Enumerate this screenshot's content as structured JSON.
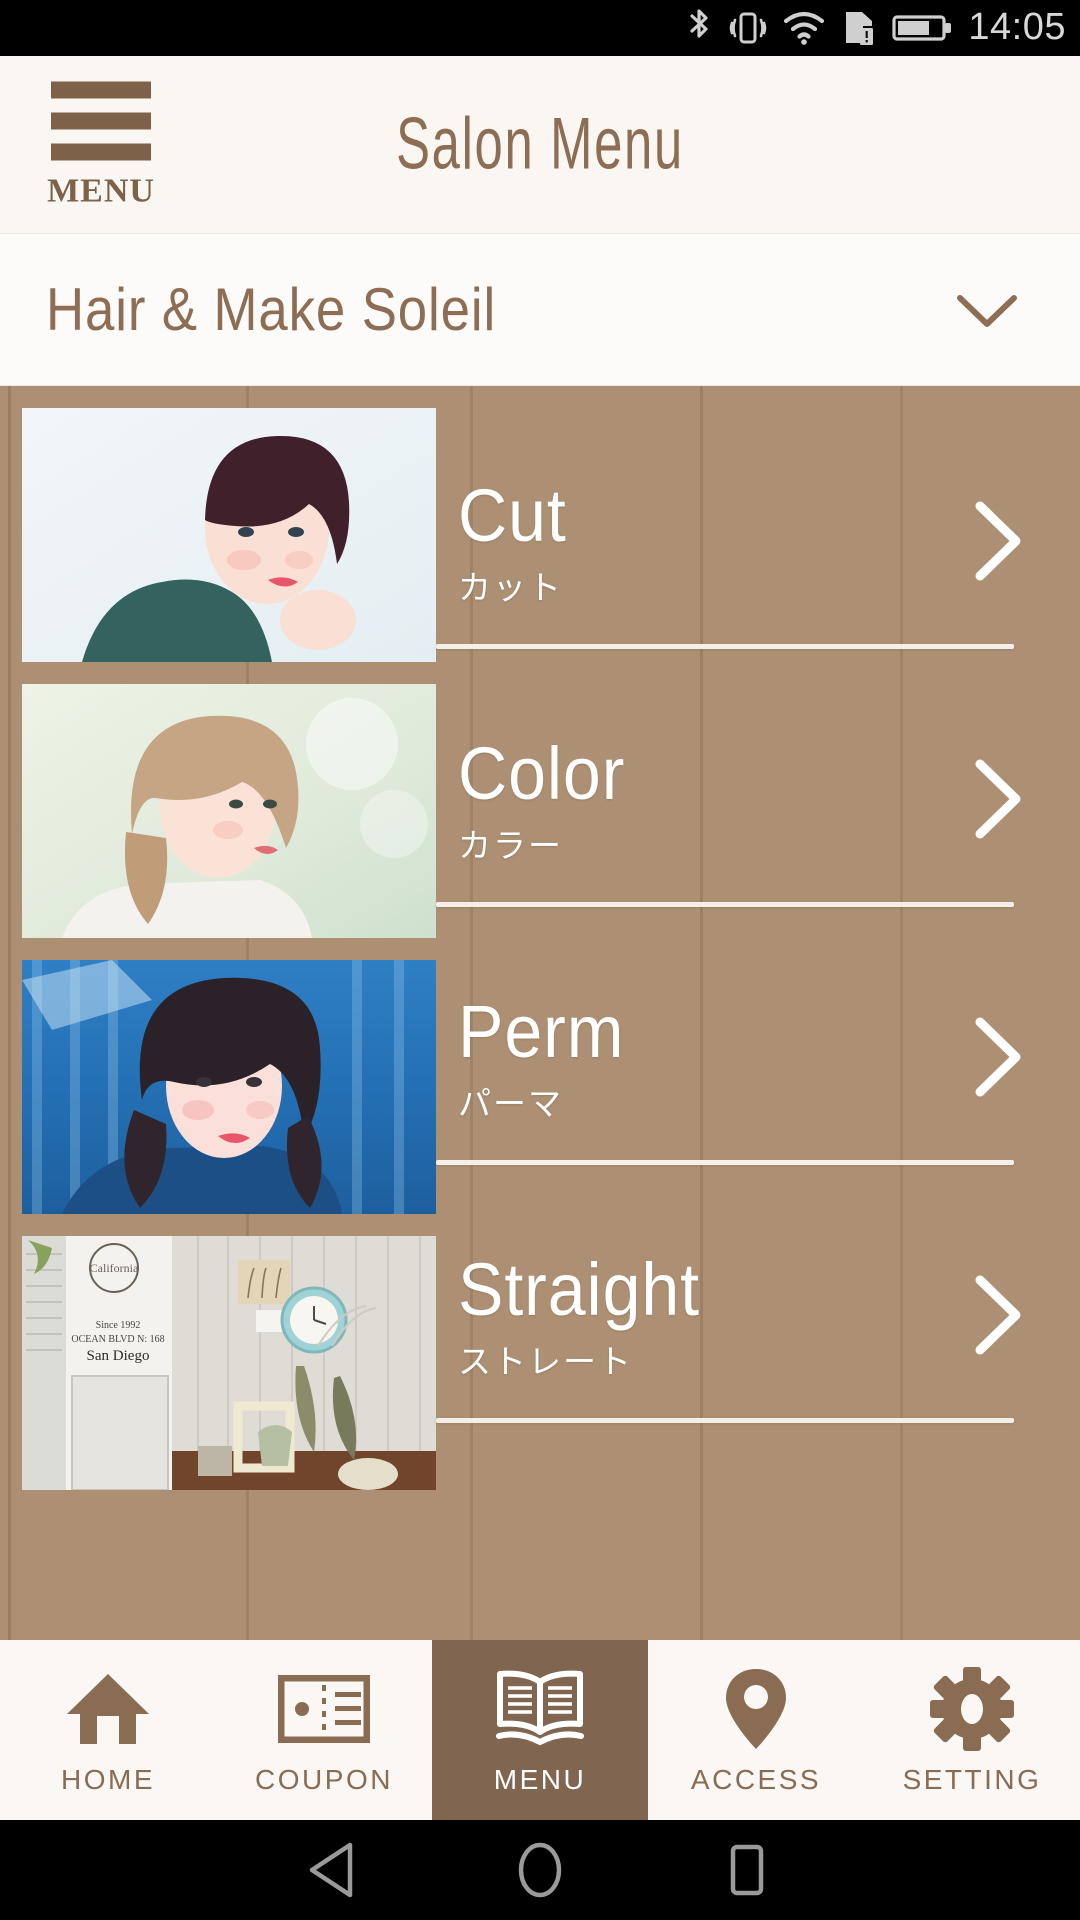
{
  "status_bar": {
    "time": "14:05",
    "icons": [
      "bluetooth-icon",
      "vibrate-icon",
      "wifi-icon",
      "sim-card-alert-icon",
      "battery-icon"
    ],
    "battery_level_percent": 70
  },
  "app_header": {
    "menu_button_label": "MENU",
    "title": "Salon Menu"
  },
  "salon_selector": {
    "name": "Hair & Make Soleil",
    "expand_icon": "chevron-down-icon"
  },
  "menu_list": {
    "items": [
      {
        "title_en": "Cut",
        "title_jp": "カット",
        "thumb_alt": "short-dark-bob-hairstyle-portrait",
        "chevron": "chevron-right-icon"
      },
      {
        "title_en": "Color",
        "title_jp": "カラー",
        "thumb_alt": "light-brown-medium-hair-portrait",
        "chevron": "chevron-right-icon"
      },
      {
        "title_en": "Perm",
        "title_jp": "パーマ",
        "thumb_alt": "wavy-dark-hair-blue-background-portrait",
        "chevron": "chevron-right-icon"
      },
      {
        "title_en": "Straight",
        "title_jp": "ストレート",
        "thumb_alt": "salon-interior-vintage-decor-clock",
        "chevron": "chevron-right-icon"
      }
    ]
  },
  "tab_bar": {
    "active_index": 2,
    "tabs": [
      {
        "label": "HOME",
        "icon": "home-icon"
      },
      {
        "label": "COUPON",
        "icon": "coupon-ticket-icon"
      },
      {
        "label": "MENU",
        "icon": "open-book-icon"
      },
      {
        "label": "ACCESS",
        "icon": "map-pin-icon"
      },
      {
        "label": "SETTING",
        "icon": "gear-icon"
      }
    ]
  },
  "android_nav": {
    "buttons": [
      "back-triangle-icon",
      "home-circle-icon",
      "recents-square-icon"
    ]
  },
  "colors": {
    "brand_brown": "#8d6e55",
    "active_tab_brown": "#806650",
    "wood_base": "#ad9073",
    "header_bg": "#faf7f3",
    "tabbar_bg": "#faf7f4"
  }
}
